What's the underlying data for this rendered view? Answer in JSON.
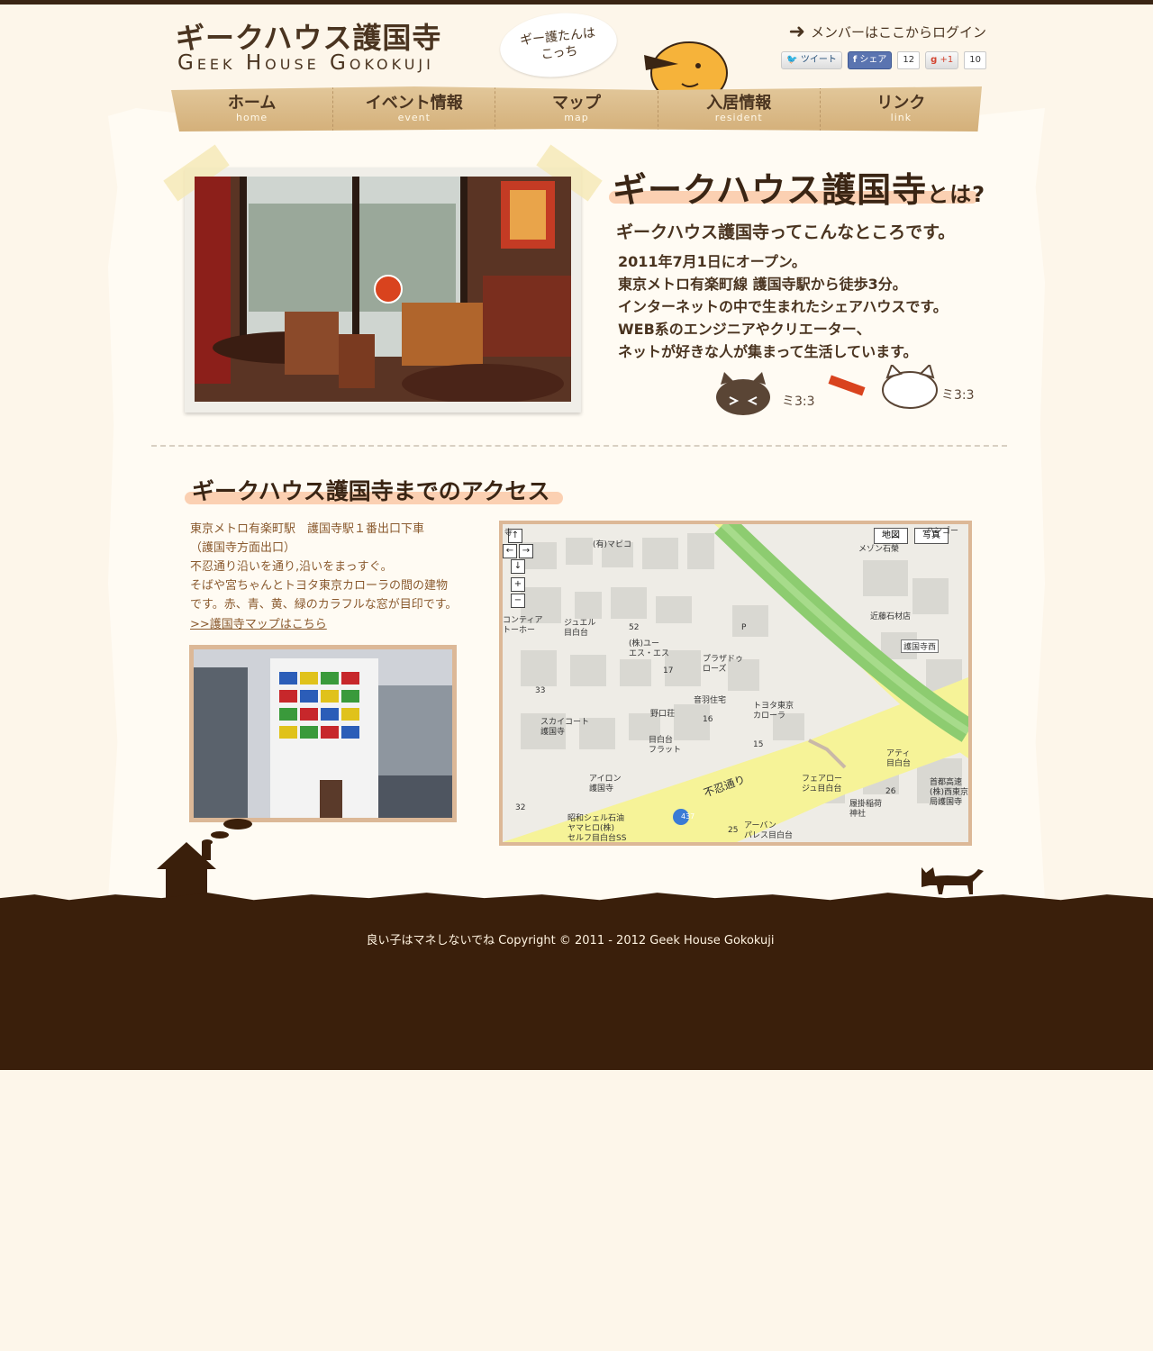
{
  "header": {
    "logo_jp": "ギークハウス護国寺",
    "logo_en": "Geek House Gokokuji",
    "bubble_text": "ギー護たんはこっち",
    "login_text": "メンバーはここからログイン",
    "tweet_label": "ツイート",
    "fb_label": "シェア",
    "fb_count": "12",
    "gplus_label": "+1",
    "gplus_count": "10"
  },
  "nav": {
    "items": [
      {
        "jp": "ホーム",
        "en": "home"
      },
      {
        "jp": "イベント情報",
        "en": "event"
      },
      {
        "jp": "マップ",
        "en": "map"
      },
      {
        "jp": "入居情報",
        "en": "resident"
      },
      {
        "jp": "リンク",
        "en": "link"
      }
    ]
  },
  "about": {
    "title": "ギークハウス護国寺",
    "title_suffix": "とは?",
    "subtitle": "ギークハウス護国寺ってこんなところです。",
    "lines": [
      "2011年7月1日にオープン。",
      "東京メトロ有楽町線 護国寺駅から徒歩3分。",
      "インターネットの中で生まれたシェアハウスです。",
      "WEB系のエンジニアやクリエーター、",
      "ネットが好きな人が集まって生活しています。"
    ]
  },
  "access": {
    "title": "ギークハウス護国寺までのアクセス",
    "lines": [
      "東京メトロ有楽町駅　護国寺駅１番出口下車",
      "（護国寺方面出口）",
      "不忍通り沿いを通り,沿いをまっすぐ。",
      "そばや宮ちゃんとトヨタ東京カローラの間の建物",
      "です。赤、青、黄、緑のカラフルな窓が目印です。"
    ],
    "map_link": ">>護国寺マップはこちら"
  },
  "map": {
    "btn_map": "地図",
    "btn_photo": "写真",
    "labels": {
      "mapico": "(有)マピコ",
      "nozeki": "近藤石材店",
      "gokokujinishi": "護国寺西",
      "jewel": "ジュエル\n目白台",
      "ues": "(株)ユー\nエス・エス",
      "plaza": "プラザドゥ\nローズ",
      "otowa": "音羽住宅",
      "toyota": "トヨタ東京\nカローラ",
      "noguchi": "野口荘",
      "skycourt": "スカイコート\n護国寺",
      "mejiro_flat": "目白台\nフラット",
      "ateii": "アティ\n目白台",
      "shinobazu": "不忍通り",
      "fairlojeu": "フェアロー\nジュ目白台",
      "shutoko": "首都高速\n(株)西東京\n局護国寺",
      "aironn": "アイロン\n護国寺",
      "showa": "昭和シェル石油\nヤマヒロ(株)\nセルフ目白台SS",
      "urban": "アーバン\nパレス目白台",
      "route": "437",
      "kake": "履掛稲荷\n神社",
      "contia": "コンティア\nトーホー",
      "n52": "52",
      "n17": "17",
      "n33": "33",
      "n16": "16",
      "n15": "15",
      "n26": "26",
      "n32": "32",
      "n25": "25",
      "nP": "P",
      "nzokuji": "寺",
      "mesonn": "メゾン石榮",
      "hanhou": "ハンゴー"
    }
  },
  "footer": {
    "copyright": "良い子はマネしないでね Copyright © 2011 - 2012 Geek House Gokokuji"
  },
  "colors": {
    "brown_dark": "#3a1f0b",
    "brown_text": "#4a3420",
    "accent_pink": "#fabe96",
    "nav_tan": "#d4b07a"
  }
}
